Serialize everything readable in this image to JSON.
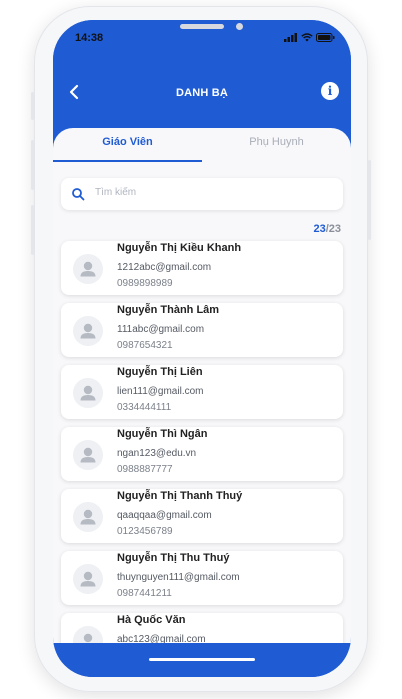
{
  "status_bar": {
    "time": "14:38"
  },
  "header": {
    "title": "DANH BẠ"
  },
  "tabs": [
    {
      "label": "Giáo Viên",
      "active": true
    },
    {
      "label": "Phụ Huynh",
      "active": false
    }
  ],
  "search": {
    "placeholder": "Tìm kiếm"
  },
  "count": {
    "current": "23",
    "total": "/23"
  },
  "contacts": [
    {
      "name": "Nguyễn Thị Kiều Khanh",
      "email": "1212abc@gmail.com",
      "phone": "0989898989"
    },
    {
      "name": "Nguyễn Thành Lâm",
      "email": "111abc@gmail.com",
      "phone": "0987654321"
    },
    {
      "name": "Nguyễn Thị Liên",
      "email": "lien111@gmail.com",
      "phone": "0334444111"
    },
    {
      "name": "Nguyễn Thì Ngân",
      "email": "ngan123@edu.vn",
      "phone": "0988887777"
    },
    {
      "name": "Nguyễn Thị Thanh Thuý",
      "email": "qaaqqaa@gmail.com",
      "phone": "0123456789"
    },
    {
      "name": "Nguyễn Thị Thu Thuý",
      "email": "thuynguyen111@gmail.com",
      "phone": "0987441211"
    },
    {
      "name": "Hà Quốc Văn",
      "email": "abc123@gmail.com",
      "phone": ""
    }
  ],
  "colors": {
    "primary": "#1f5bd3",
    "background": "#f8f8fa"
  }
}
